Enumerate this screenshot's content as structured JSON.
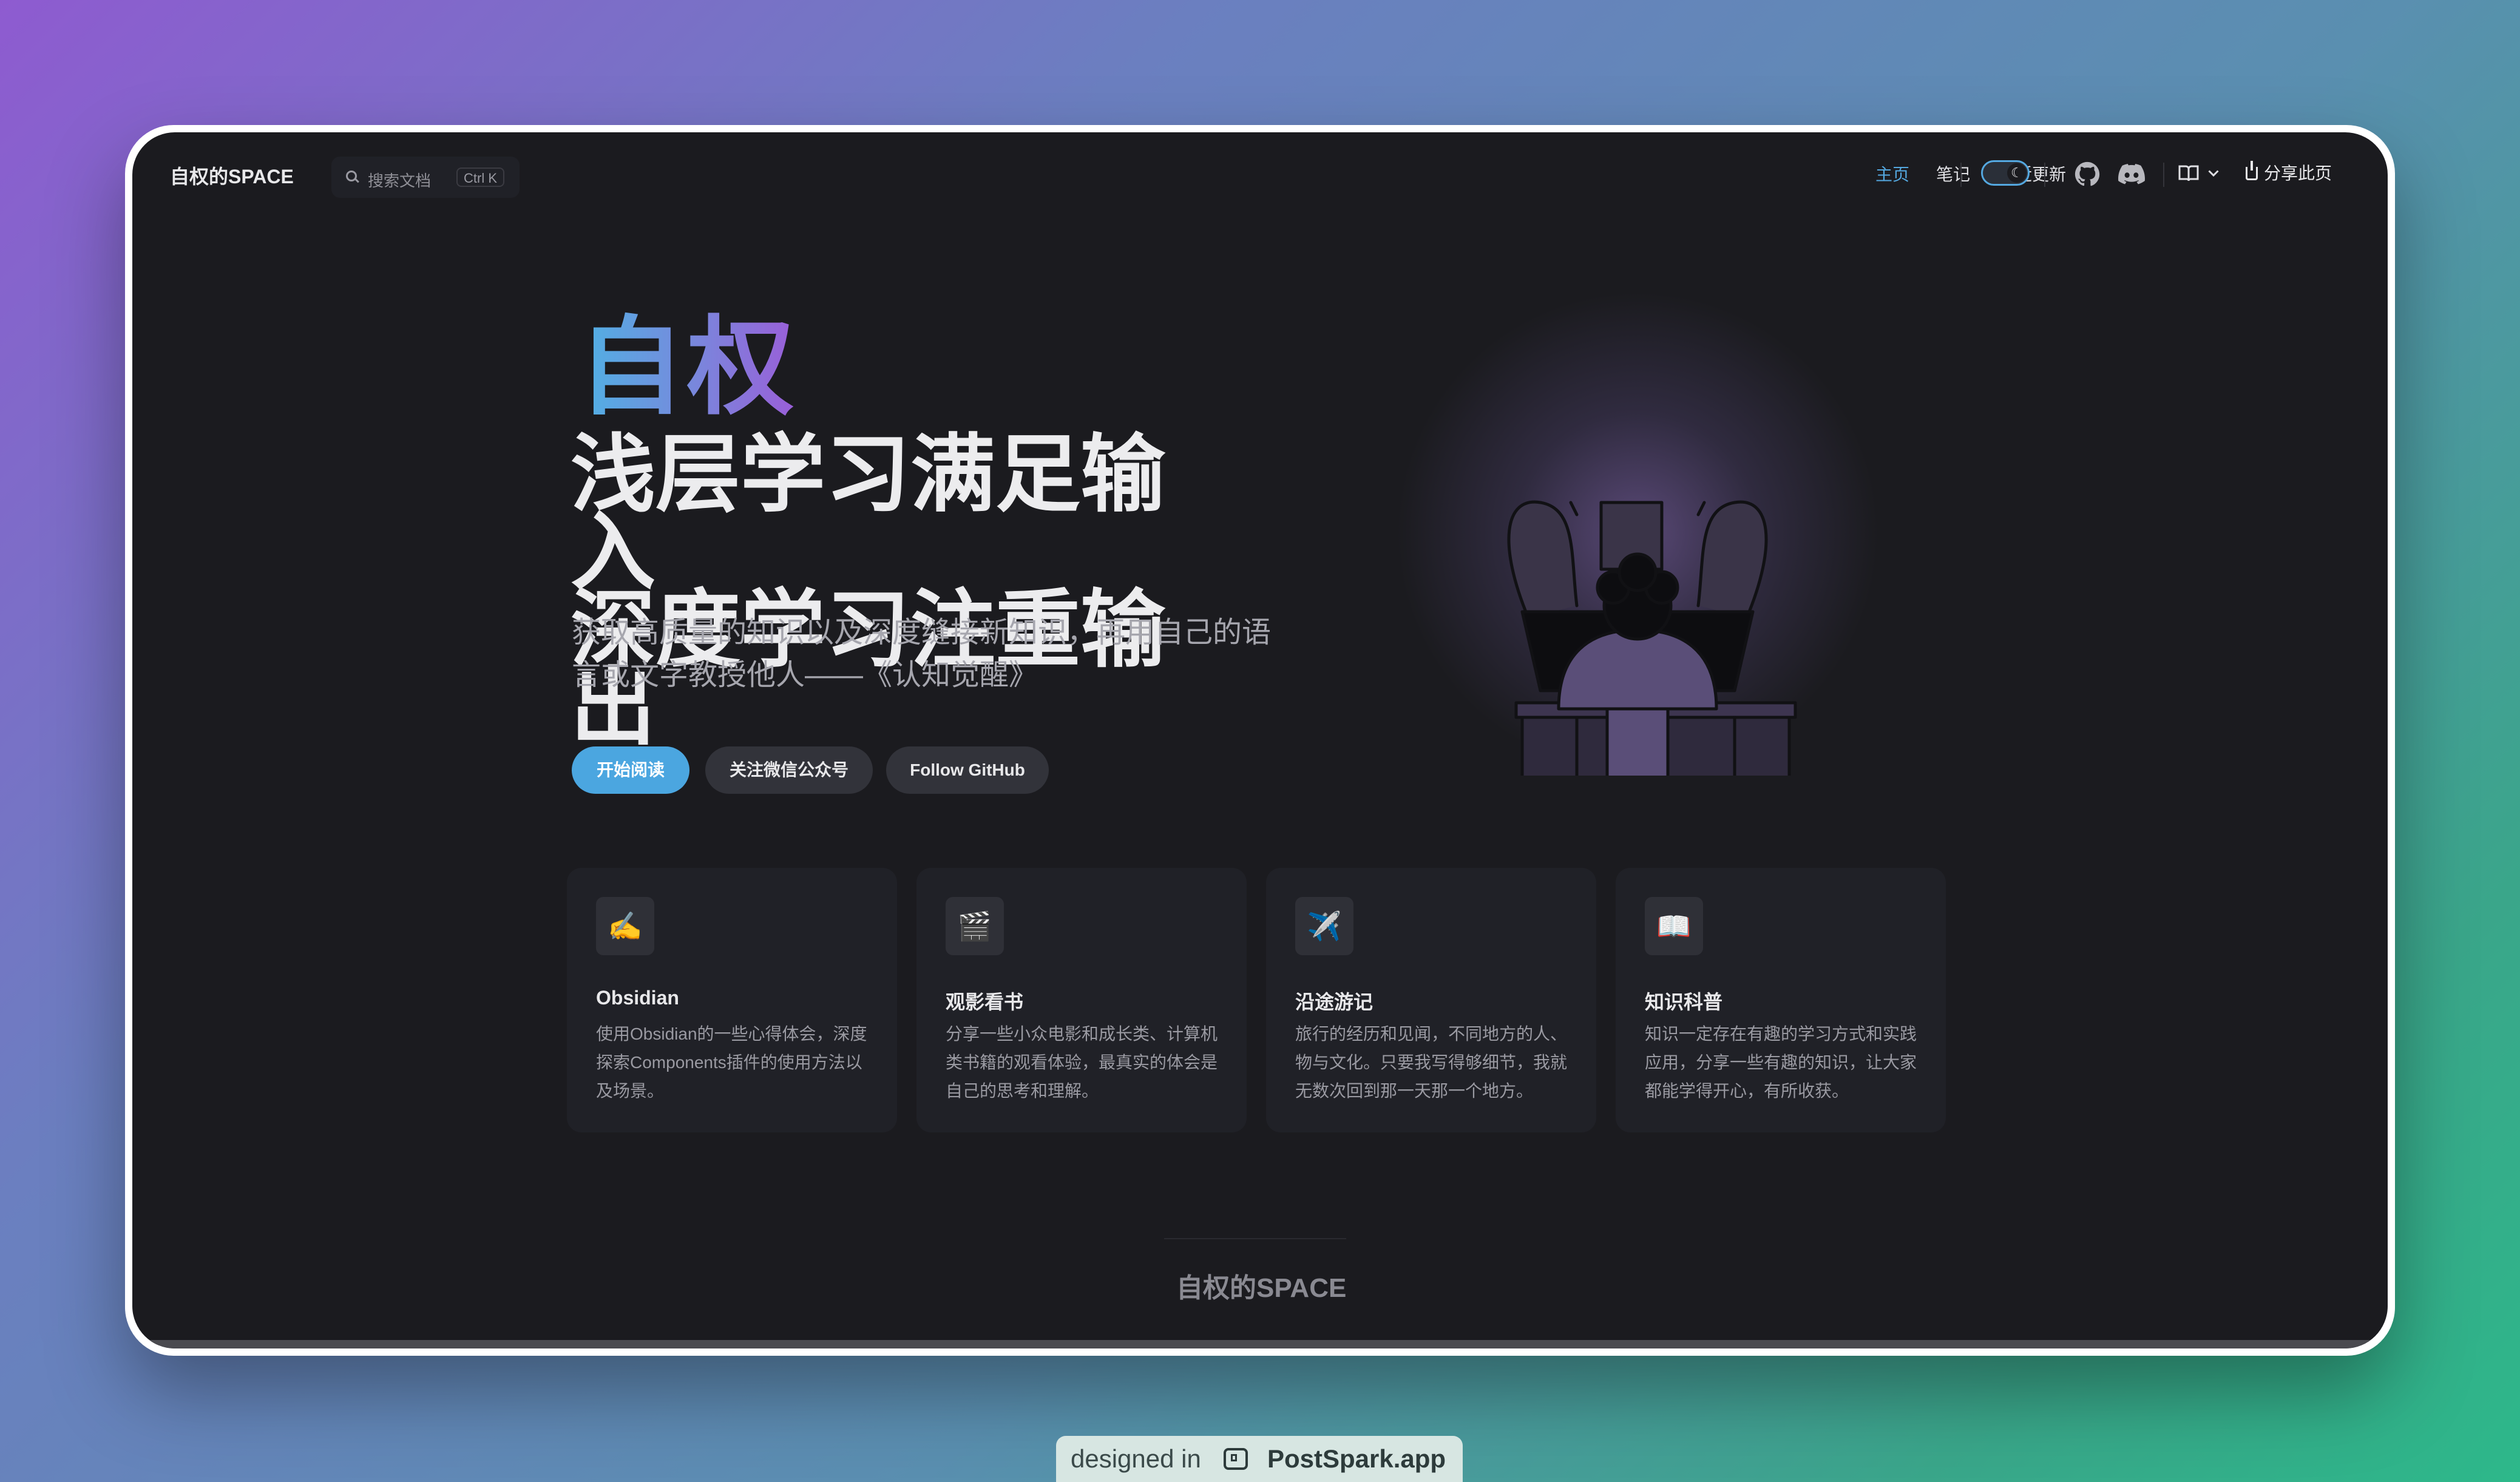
{
  "nav": {
    "brand": "自权的SPACE",
    "search_placeholder": "搜索文档",
    "search_shortcut": "Ctrl K",
    "links": [
      {
        "label": "主页",
        "active": true
      },
      {
        "label": "笔记",
        "active": false
      },
      {
        "label": "最近更新",
        "active": false
      }
    ],
    "share_label": "分享此页",
    "icons": [
      "search-icon",
      "moon-icon",
      "github-icon",
      "discord-icon",
      "book-icon",
      "chevron-down-icon",
      "share-icon"
    ],
    "accent_color": "#54a8e0"
  },
  "hero": {
    "name": "自权",
    "title_line1": "浅层学习满足输入",
    "title_line2": "深度学习注重输出",
    "tagline": "获取高质量的知识以及深度缝接新知识，再用自己的语言或文字教授他人——《认知觉醒》",
    "actions": [
      {
        "label": "开始阅读",
        "style": "primary"
      },
      {
        "label": "关注微信公众号",
        "style": "secondary"
      },
      {
        "label": "Follow GitHub",
        "style": "secondary"
      }
    ]
  },
  "features": [
    {
      "icon": "✍️",
      "title": "Obsidian",
      "desc": "使用Obsidian的一些心得体会，深度探索Components插件的使用方法以及场景。"
    },
    {
      "icon": "🎬",
      "title": "观影看书",
      "desc": "分享一些小众电影和成长类、计算机类书籍的观看体验，最真实的体会是自己的思考和理解。"
    },
    {
      "icon": "✈️",
      "title": "沿途游记",
      "desc": "旅行的经历和见闻，不同地方的人、物与文化。只要我写得够细节，我就无数次回到那一天那一个地方。"
    },
    {
      "icon": "📖",
      "title": "知识科普",
      "desc": "知识一定存在有趣的学习方式和实践应用，分享一些有趣的知识，让大家都能学得开心，有所收获。"
    }
  ],
  "footer": {
    "brand": "自权的SPACE"
  },
  "watermark": {
    "prefix": "designed in",
    "brand": "PostSpark.app"
  }
}
